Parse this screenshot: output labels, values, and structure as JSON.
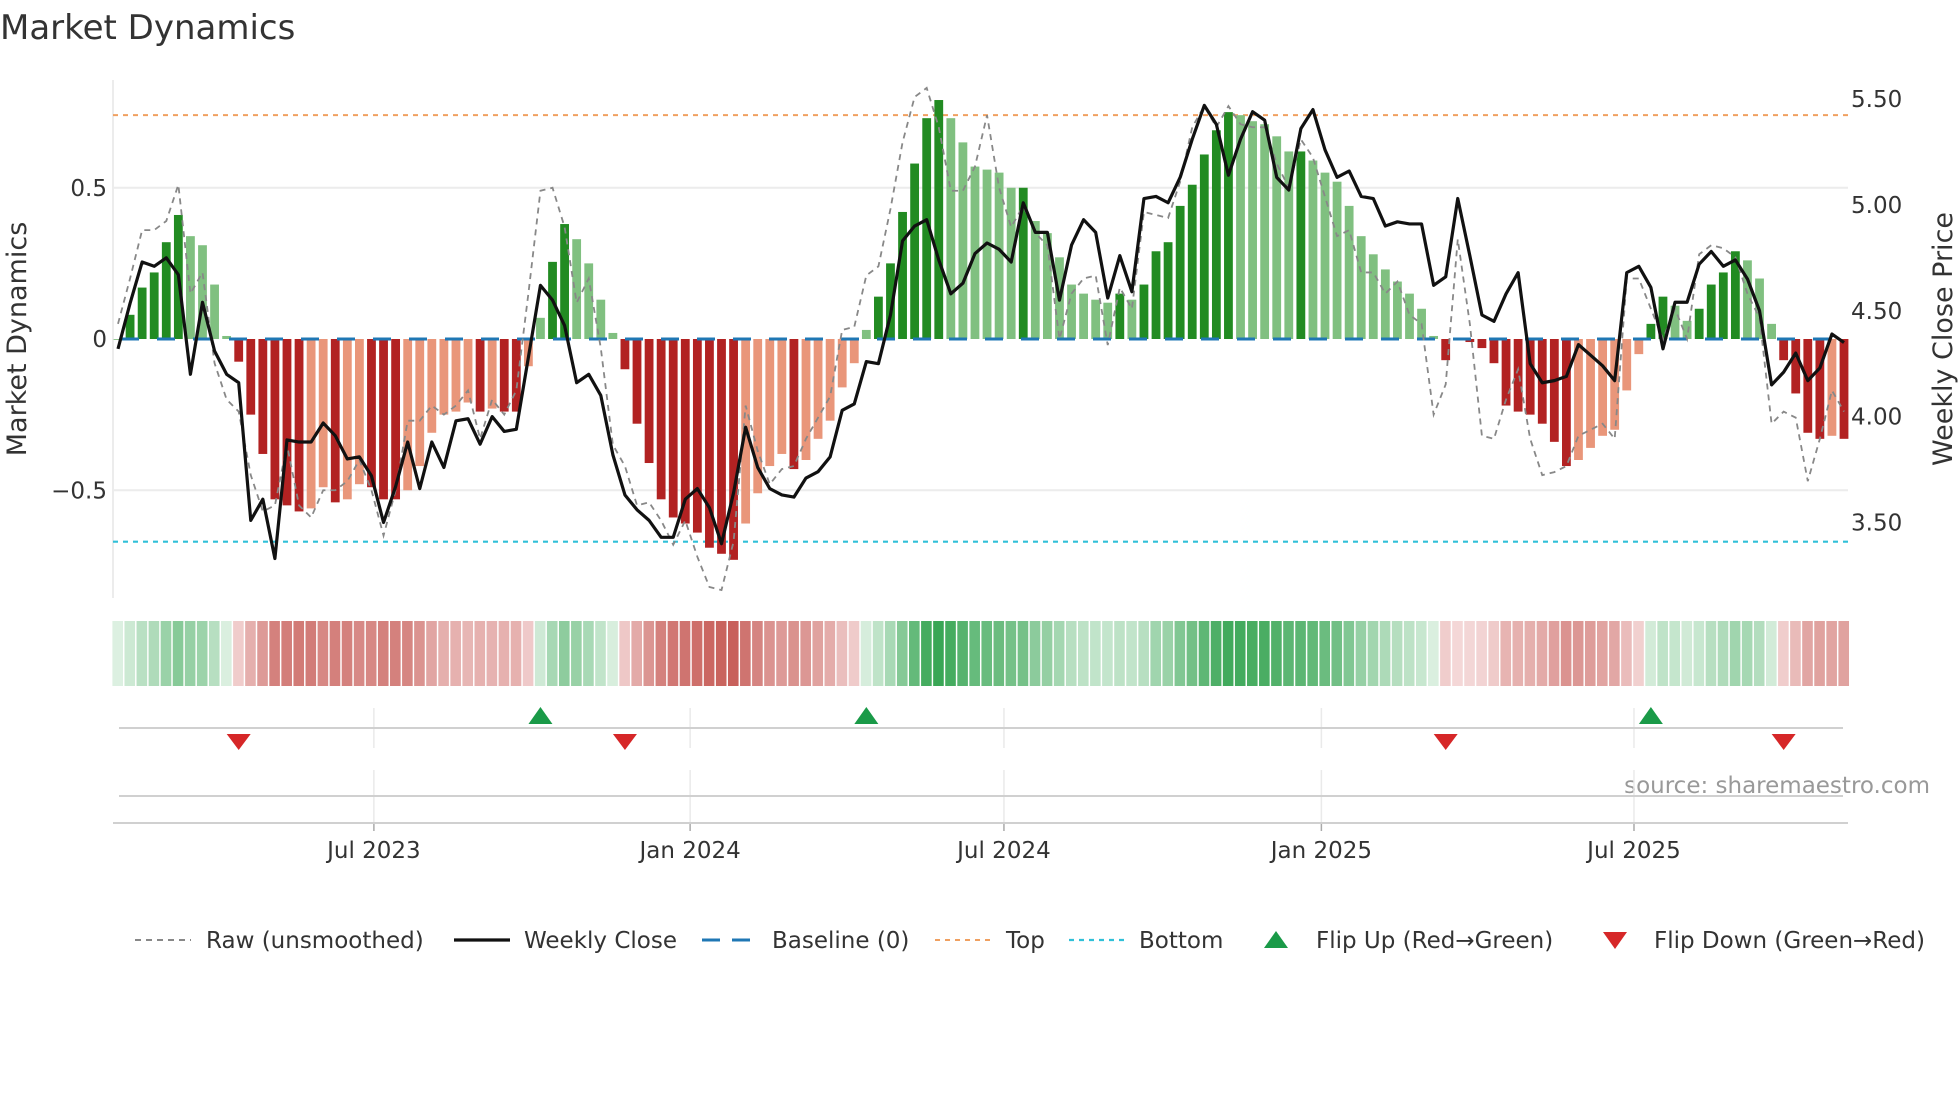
{
  "chart_data": {
    "type": "bar",
    "title": "Market Dynamics",
    "ylabel": "Market Dynamics",
    "ylabel_right": "Weekly Close Price",
    "ylim": [
      -0.86,
      0.86
    ],
    "ylim_right": [
      3.21,
      5.6
    ],
    "grid": true,
    "legend_placement": "bottom",
    "source": "source: sharemaestro.com",
    "y_ticks": [
      {
        "value": 0.5,
        "label": "0.5"
      },
      {
        "value": 0,
        "label": "0"
      },
      {
        "value": -0.5,
        "label": "−0.5"
      }
    ],
    "y_right_ticks": [
      {
        "value": 5.5,
        "label": "5.50"
      },
      {
        "value": 5.0,
        "label": "5.00"
      },
      {
        "value": 4.5,
        "label": "4.50"
      },
      {
        "value": 4.0,
        "label": "4.00"
      },
      {
        "value": 3.5,
        "label": "3.50"
      }
    ],
    "x_ticks": [
      {
        "week": 21.2,
        "label": "Jul 2023"
      },
      {
        "week": 47.4,
        "label": "Jan 2024"
      },
      {
        "week": 73.4,
        "label": "Jul 2024"
      },
      {
        "week": 99.7,
        "label": "Jan 2025"
      },
      {
        "week": 125.6,
        "label": "Jul 2025"
      }
    ],
    "top_level": 0.74,
    "bottom_level": -0.67,
    "baseline": 0,
    "colors": {
      "pos_strong": "#228b22",
      "pos_weak": "#80c080",
      "neg_strong": "#b22222",
      "neg_weak": "#e9967a",
      "close": "#111111",
      "raw": "#888888",
      "baseline": "#1f77b4",
      "top": "#f0a060",
      "bottom": "#30c0d8",
      "flip_up": "#1a9a48",
      "flip_down": "#d62728"
    },
    "legend": [
      {
        "key": "raw",
        "label": "Raw (unsmoothed)"
      },
      {
        "key": "close",
        "label": "Weekly Close"
      },
      {
        "key": "baseline",
        "label": "Baseline (0)"
      },
      {
        "key": "top",
        "label": "Top"
      },
      {
        "key": "bottom",
        "label": "Bottom"
      },
      {
        "key": "flip_up",
        "label": "Flip Up (Red→Green)"
      },
      {
        "key": "flip_down",
        "label": "Flip Down (Green→Red)"
      }
    ],
    "flips": [
      {
        "week": 10,
        "dir": "down"
      },
      {
        "week": 35,
        "dir": "up"
      },
      {
        "week": 42,
        "dir": "down"
      },
      {
        "week": 62,
        "dir": "up"
      },
      {
        "week": 110,
        "dir": "down"
      },
      {
        "week": 127,
        "dir": "up"
      },
      {
        "week": 138,
        "dir": "down"
      }
    ],
    "momentum": [
      0.0,
      0.08,
      0.17,
      0.22,
      0.32,
      0.41,
      0.34,
      0.31,
      0.18,
      0.01,
      -0.075,
      -0.25,
      -0.38,
      -0.53,
      -0.55,
      -0.57,
      -0.56,
      -0.49,
      -0.54,
      -0.53,
      -0.48,
      -0.49,
      -0.53,
      -0.53,
      -0.5,
      -0.42,
      -0.31,
      -0.25,
      -0.24,
      -0.21,
      -0.24,
      -0.23,
      -0.24,
      -0.24,
      -0.09,
      0.07,
      0.255,
      0.38,
      0.33,
      0.25,
      0.13,
      0.02,
      -0.1,
      -0.28,
      -0.41,
      -0.53,
      -0.59,
      -0.61,
      -0.64,
      -0.69,
      -0.71,
      -0.73,
      -0.61,
      -0.51,
      -0.42,
      -0.38,
      -0.43,
      -0.4,
      -0.33,
      -0.27,
      -0.16,
      -0.08,
      0.03,
      0.14,
      0.25,
      0.42,
      0.58,
      0.73,
      0.79,
      0.73,
      0.65,
      0.57,
      0.56,
      0.55,
      0.5,
      0.5,
      0.39,
      0.35,
      0.27,
      0.18,
      0.15,
      0.13,
      0.12,
      0.15,
      0.13,
      0.18,
      0.29,
      0.32,
      0.44,
      0.51,
      0.61,
      0.69,
      0.75,
      0.74,
      0.72,
      0.71,
      0.67,
      0.62,
      0.62,
      0.59,
      0.55,
      0.52,
      0.44,
      0.34,
      0.28,
      0.23,
      0.19,
      0.15,
      0.1,
      0.01,
      -0.07,
      -0.005,
      -0.01,
      -0.03,
      -0.08,
      -0.22,
      -0.24,
      -0.25,
      -0.28,
      -0.34,
      -0.42,
      -0.4,
      -0.36,
      -0.32,
      -0.3,
      -0.17,
      -0.05,
      0.05,
      0.14,
      0.11,
      0.06,
      0.1,
      0.18,
      0.22,
      0.29,
      0.26,
      0.2,
      0.05,
      -0.07,
      -0.18,
      -0.31,
      -0.33,
      -0.32,
      -0.33
    ],
    "raw": [
      0.05,
      0.2,
      0.36,
      0.36,
      0.39,
      0.51,
      0.15,
      0.22,
      -0.08,
      -0.2,
      -0.24,
      -0.45,
      -0.57,
      -0.55,
      -0.35,
      -0.55,
      -0.59,
      -0.5,
      -0.5,
      -0.47,
      -0.4,
      -0.5,
      -0.65,
      -0.5,
      -0.27,
      -0.27,
      -0.22,
      -0.25,
      -0.22,
      -0.17,
      -0.33,
      -0.2,
      -0.25,
      -0.17,
      0.15,
      0.49,
      0.5,
      0.37,
      0.12,
      0.2,
      -0.03,
      -0.35,
      -0.42,
      -0.55,
      -0.54,
      -0.6,
      -0.68,
      -0.6,
      -0.72,
      -0.82,
      -0.83,
      -0.67,
      -0.22,
      -0.37,
      -0.48,
      -0.43,
      -0.42,
      -0.33,
      -0.26,
      -0.19,
      0.03,
      0.04,
      0.21,
      0.24,
      0.43,
      0.65,
      0.8,
      0.83,
      0.7,
      0.49,
      0.49,
      0.57,
      0.74,
      0.5,
      0.37,
      0.44,
      0.35,
      0.31,
      0.0,
      0.15,
      0.2,
      0.21,
      -0.02,
      0.17,
      0.1,
      0.42,
      0.41,
      0.4,
      0.52,
      0.7,
      0.77,
      0.7,
      0.77,
      0.71,
      0.7,
      0.7,
      0.58,
      0.5,
      0.66,
      0.6,
      0.47,
      0.34,
      0.36,
      0.22,
      0.22,
      0.15,
      0.19,
      0.08,
      0.05,
      -0.25,
      -0.15,
      0.33,
      0.05,
      -0.32,
      -0.33,
      -0.2,
      -0.1,
      -0.33,
      -0.45,
      -0.44,
      -0.42,
      -0.32,
      -0.3,
      -0.28,
      -0.33,
      0.2,
      0.2,
      0.1,
      0.0,
      0.1,
      0.0,
      0.28,
      0.31,
      0.3,
      0.27,
      0.15,
      0.07,
      -0.28,
      -0.24,
      -0.26,
      -0.47,
      -0.33,
      -0.17,
      -0.24
    ],
    "close": [
      4.32,
      4.535,
      4.73,
      4.71,
      4.75,
      4.67,
      4.2,
      4.54,
      4.31,
      4.2,
      4.16,
      3.51,
      3.61,
      3.33,
      3.89,
      3.88,
      3.88,
      3.97,
      3.91,
      3.8,
      3.81,
      3.72,
      3.5,
      3.67,
      3.88,
      3.66,
      3.88,
      3.76,
      3.98,
      3.99,
      3.87,
      4.0,
      3.93,
      3.94,
      4.28,
      4.62,
      4.55,
      4.43,
      4.16,
      4.2,
      4.1,
      3.82,
      3.63,
      3.56,
      3.51,
      3.43,
      3.43,
      3.61,
      3.66,
      3.57,
      3.4,
      3.64,
      3.95,
      3.76,
      3.66,
      3.63,
      3.62,
      3.71,
      3.74,
      3.81,
      4.03,
      4.06,
      4.26,
      4.25,
      4.48,
      4.83,
      4.9,
      4.93,
      4.74,
      4.58,
      4.63,
      4.77,
      4.82,
      4.79,
      4.73,
      5.01,
      4.87,
      4.87,
      4.55,
      4.81,
      4.93,
      4.87,
      4.56,
      4.76,
      4.59,
      5.03,
      5.04,
      5.01,
      5.13,
      5.31,
      5.47,
      5.38,
      5.14,
      5.31,
      5.44,
      5.4,
      5.13,
      5.07,
      5.36,
      5.45,
      5.26,
      5.13,
      5.16,
      5.04,
      5.03,
      4.9,
      4.92,
      4.91,
      4.91,
      4.62,
      4.66,
      5.03,
      4.76,
      4.48,
      4.45,
      4.58,
      4.68,
      4.25,
      4.16,
      4.17,
      4.19,
      4.34,
      4.29,
      4.24,
      4.17,
      4.68,
      4.71,
      4.61,
      4.32,
      4.54,
      4.54,
      4.72,
      4.78,
      4.71,
      4.74,
      4.65,
      4.5,
      4.15,
      4.21,
      4.3,
      4.17,
      4.23,
      4.39,
      4.35
    ]
  }
}
